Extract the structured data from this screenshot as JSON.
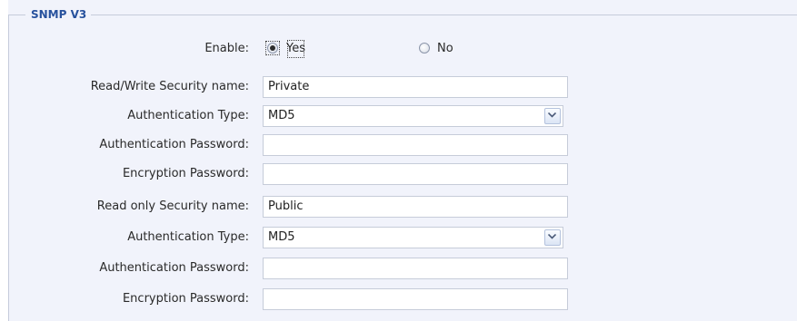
{
  "section": {
    "legend": "SNMP V3"
  },
  "enable": {
    "label": "Enable:",
    "options": [
      {
        "label": "Yes",
        "selected": true
      },
      {
        "label": "No",
        "selected": false
      }
    ]
  },
  "read_write": {
    "security_name": {
      "label": "Read/Write Security name:",
      "value": "Private"
    },
    "auth_type": {
      "label": "Authentication Type:",
      "value": "MD5"
    },
    "auth_password": {
      "label": "Authentication Password:",
      "value": ""
    },
    "enc_password": {
      "label": "Encryption Password:",
      "value": ""
    }
  },
  "read_only": {
    "security_name": {
      "label": "Read only Security name:",
      "value": "Public"
    },
    "auth_type": {
      "label": "Authentication Type:",
      "value": "MD5"
    },
    "auth_password": {
      "label": "Authentication Password:",
      "value": ""
    },
    "enc_password": {
      "label": "Encryption Password:",
      "value": ""
    }
  },
  "icons": {
    "dropdown": "chevron-down-icon"
  },
  "colors": {
    "legend": "#27519d",
    "panel_background": "#f1f3fb",
    "field_border": "#c6ccd9"
  }
}
